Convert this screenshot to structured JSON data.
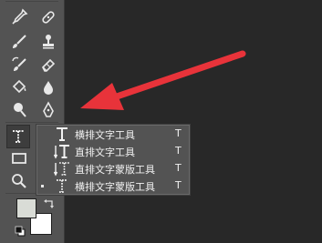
{
  "toolbar": {
    "tools": [
      {
        "name": "eyedropper-icon"
      },
      {
        "name": "healing-brush-icon"
      },
      {
        "name": "brush-icon"
      },
      {
        "name": "clone-stamp-icon"
      },
      {
        "name": "history-brush-icon"
      },
      {
        "name": "eraser-icon"
      },
      {
        "name": "paint-bucket-icon"
      },
      {
        "name": "blur-icon"
      },
      {
        "name": "dodge-icon"
      },
      {
        "name": "pen-icon"
      },
      {
        "name": "type-tool-icon"
      },
      {
        "name": "path-select-icon"
      },
      {
        "name": "rectangle-icon"
      },
      {
        "name": "zoom-icon"
      }
    ]
  },
  "flyout_menu": {
    "items": [
      {
        "label": "横排文字工具",
        "shortcut": "T",
        "icon": "horizontal-type-icon",
        "selected": false
      },
      {
        "label": "直排文字工具",
        "shortcut": "T",
        "icon": "vertical-type-icon",
        "selected": false
      },
      {
        "label": "直排文字蒙版工具",
        "shortcut": "T",
        "icon": "vertical-type-mask-icon",
        "selected": false
      },
      {
        "label": "横排文字蒙版工具",
        "shortcut": "T",
        "icon": "horizontal-type-mask-icon",
        "selected": true
      }
    ]
  },
  "colors": {
    "foreground": "#d9dcd6",
    "background": "#ffffff",
    "annotation_arrow": "#e8333a"
  }
}
